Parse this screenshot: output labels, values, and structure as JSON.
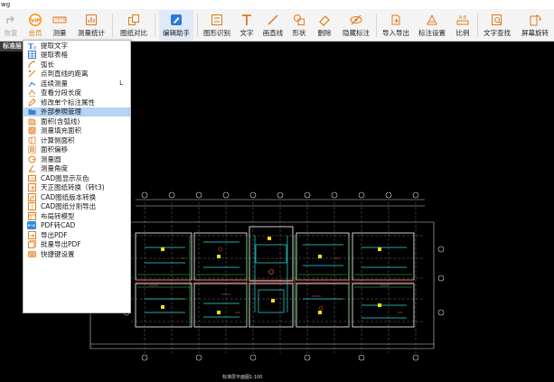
{
  "window": {
    "title": "wg"
  },
  "toolbar": {
    "items": [
      {
        "label": "恢复",
        "icon": "redo-icon",
        "disabled": true
      },
      {
        "label": "会员",
        "icon": "vip-icon"
      },
      {
        "label": "测量",
        "icon": "ruler-icon"
      },
      {
        "label": "测量统计",
        "icon": "stats-icon"
      },
      {
        "label": "图纸对比",
        "icon": "compare-icon"
      },
      {
        "label": "编辑助手",
        "icon": "edit-assistant-icon",
        "active": true
      },
      {
        "label": "图形识别",
        "icon": "shape-recognition-icon"
      },
      {
        "label": "文字",
        "icon": "text-icon"
      },
      {
        "label": "画直线",
        "icon": "line-icon"
      },
      {
        "label": "形状",
        "icon": "shape-icon"
      },
      {
        "label": "删除",
        "icon": "eraser-icon"
      },
      {
        "label": "隐藏标注",
        "icon": "hide-annotation-icon"
      },
      {
        "label": "导入导出",
        "icon": "import-export-icon"
      },
      {
        "label": "标注设置",
        "icon": "annotation-settings-icon"
      },
      {
        "label": "比例",
        "icon": "scale-icon"
      },
      {
        "label": "文字查找",
        "icon": "text-search-icon"
      },
      {
        "label": "屏幕旋转",
        "icon": "rotate-screen-icon"
      }
    ]
  },
  "canvas": {
    "layer_tab": "标准层",
    "drawing_caption": "标准层平面图1:100"
  },
  "menu": {
    "items": [
      {
        "label": "提取文字",
        "icon": "extract-text-icon",
        "color": "#3d7fd6"
      },
      {
        "label": "提取表格",
        "icon": "extract-table-icon",
        "color": "#3d7fd6"
      },
      {
        "label": "弧长",
        "icon": "arc-length-icon",
        "color": "#e07a1a"
      },
      {
        "label": "点到直线的距离",
        "icon": "point-line-distance-icon",
        "color": "#e07a1a"
      },
      {
        "label": "连续测量",
        "icon": "continuous-measure-icon",
        "color": "#3d7fd6",
        "shortcut": "L"
      },
      {
        "label": "查看分段长度",
        "icon": "segment-length-icon",
        "color": "#e07a1a"
      },
      {
        "label": "修改单个标注属性",
        "icon": "edit-annotation-icon",
        "color": "#e07a1a"
      },
      {
        "label": "外部参照管理",
        "icon": "xref-manage-icon",
        "color": "#3d7fd6",
        "highlighted": true
      },
      {
        "label": "面积(含弧线)",
        "icon": "area-arc-icon",
        "color": "#e07a1a"
      },
      {
        "label": "测量填充面积",
        "icon": "fill-area-icon",
        "color": "#e07a1a"
      },
      {
        "label": "计算侧面积",
        "icon": "side-area-icon",
        "color": "#e07a1a"
      },
      {
        "label": "面积偏移",
        "icon": "area-offset-icon",
        "color": "#e07a1a"
      },
      {
        "label": "测量圆",
        "icon": "measure-circle-icon",
        "color": "#e07a1a"
      },
      {
        "label": "测量角度",
        "icon": "measure-angle-icon",
        "color": "#e07a1a"
      },
      {
        "label": "CAD图显示灰色",
        "icon": "gray-display-icon",
        "color": "#e07a1a"
      },
      {
        "label": "天正图纸转换（转t3)",
        "icon": "tangent-convert-icon",
        "color": "#e07a1a"
      },
      {
        "label": "CAD图纸版本转换",
        "icon": "version-convert-icon",
        "color": "#e07a1a"
      },
      {
        "label": "CAD图纸分割导出",
        "icon": "split-export-icon",
        "color": "#e07a1a"
      },
      {
        "label": "布局转模型",
        "icon": "layout-model-icon",
        "color": "#e07a1a"
      },
      {
        "label": "PDF转CAD",
        "icon": "pdf-cad-icon",
        "color": "#2a8ce0"
      },
      {
        "label": "导出PDF",
        "icon": "export-pdf-icon",
        "color": "#e07a1a"
      },
      {
        "label": "批量导出PDF",
        "icon": "batch-export-pdf-icon",
        "color": "#e07a1a"
      },
      {
        "label": "快捷键设置",
        "icon": "shortcut-settings-icon",
        "color": "#e07a1a"
      }
    ]
  },
  "colors": {
    "accent_orange": "#e07a1a",
    "accent_blue": "#3d7fd6",
    "highlight": "#b5d3f3",
    "canvas_bg": "#000000"
  }
}
